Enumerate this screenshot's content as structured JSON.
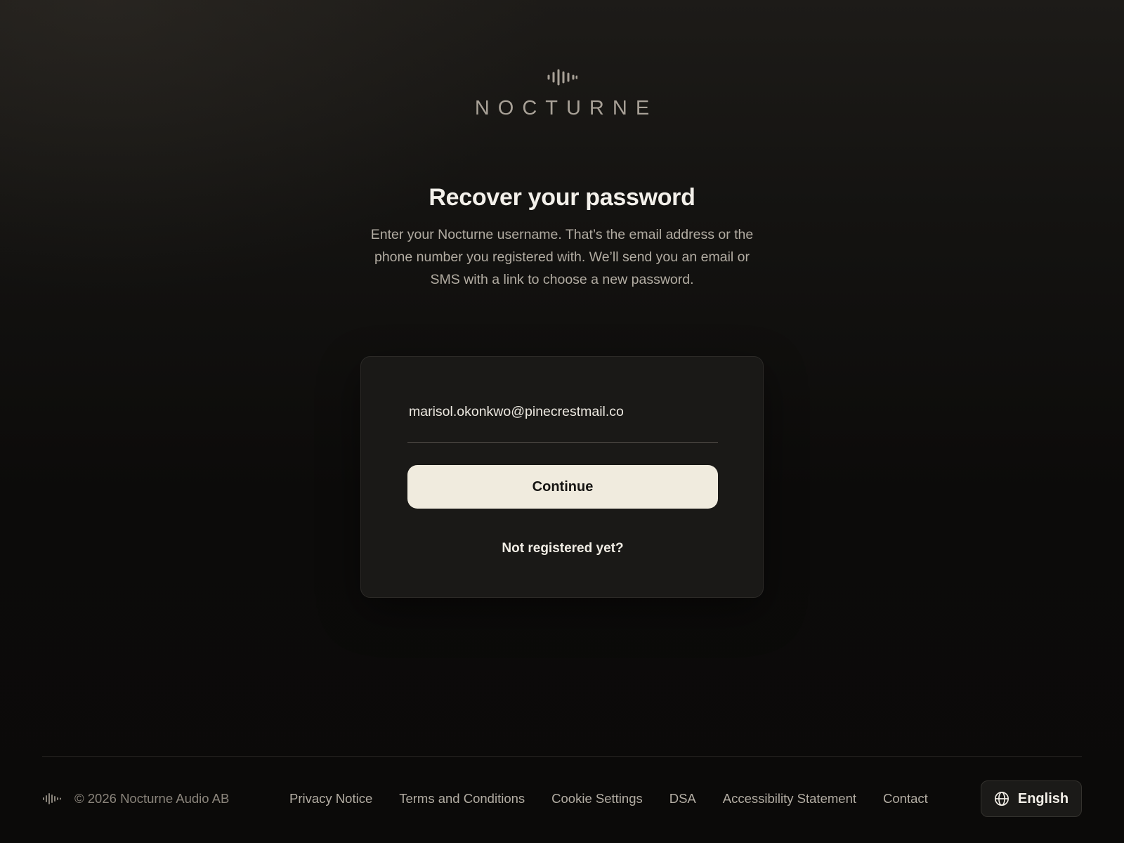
{
  "brand": {
    "name": "NOCTURNE",
    "logo_icon": "soundwave-icon"
  },
  "main": {
    "title": "Recover your password",
    "description": "Enter your Nocturne username. That’s the email address or the phone number you registered with. We’ll send you an email or SMS with a link to choose a new password."
  },
  "form": {
    "username_value": "marisol.okonkwo@pinecrestmail.co",
    "continue_label": "Continue",
    "register_link": "Not registered yet?"
  },
  "footer": {
    "copyright": "© 2026 Nocturne Audio AB",
    "links": [
      "Privacy Notice",
      "Terms and Conditions",
      "Cookie Settings",
      "DSA",
      "Accessibility Statement",
      "Contact"
    ],
    "language": {
      "label": "English",
      "icon": "globe-icon"
    }
  },
  "colors": {
    "background": "#0c0b0a",
    "card": "#1a1917",
    "accent_button": "#f0ebde",
    "logo": "#a8a197"
  }
}
